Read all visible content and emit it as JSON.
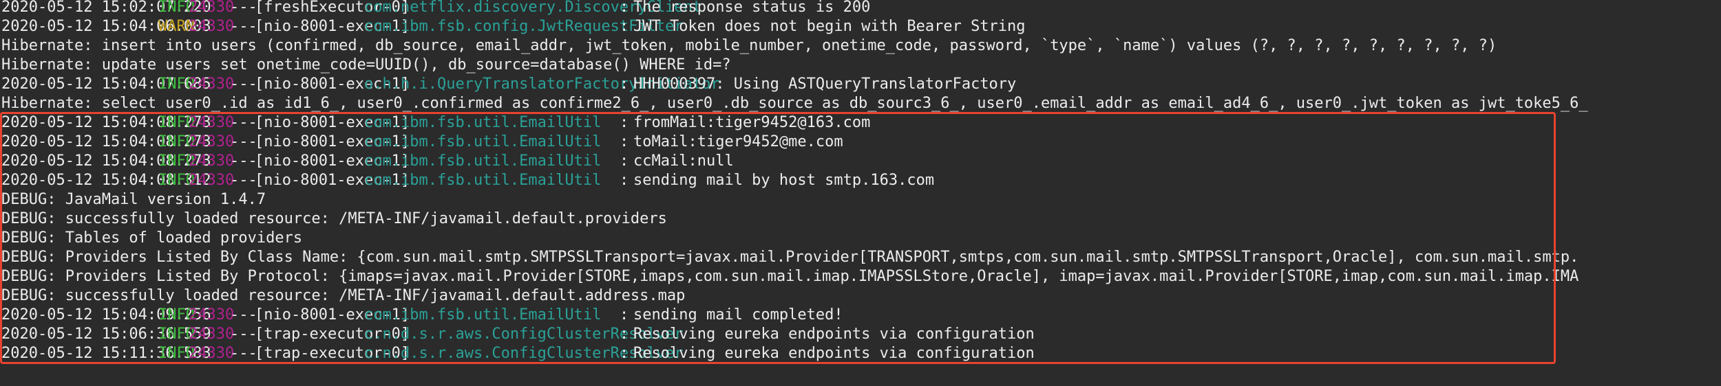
{
  "terminal": {
    "lines": [
      {
        "kind": "log",
        "ts": "2020-05-12 15:02:07.220",
        "level": "INFO",
        "pid": "24330",
        "sep": "---",
        "thread": "[freshExecutor-0]",
        "logger": "com.netflix.discovery.DiscoveryClient",
        "msg": "The response status is 200"
      },
      {
        "kind": "log",
        "ts": "2020-05-12 15:04:06.003",
        "level": "WARN",
        "pid": "24330",
        "sep": "---",
        "thread": "[nio-8001-exec-1]",
        "logger": "com.ibm.fsb.config.JwtRequestFilter",
        "msg": "JWT Token does not begin with Bearer String"
      },
      {
        "kind": "plain",
        "text": "Hibernate: insert into users (confirmed, db_source, email_addr, jwt_token, mobile_number, onetime_code, password, `type`, `name`) values (?, ?, ?, ?, ?, ?, ?, ?, ?)"
      },
      {
        "kind": "plain",
        "text": "Hibernate: update users set onetime_code=UUID(), db_source=database() WHERE id=?"
      },
      {
        "kind": "log",
        "ts": "2020-05-12 15:04:07.685",
        "level": "INFO",
        "pid": "24330",
        "sep": "---",
        "thread": "[nio-8001-exec-1]",
        "logger": "o.h.h.i.QueryTranslatorFactoryInitiator",
        "msg": "HHH000397: Using ASTQueryTranslatorFactory"
      },
      {
        "kind": "plain",
        "text": "Hibernate: select user0_.id as id1_6_, user0_.confirmed as confirme2_6_, user0_.db_source as db_sourc3_6_, user0_.email_addr as email_ad4_6_, user0_.jwt_token as jwt_toke5_6_"
      },
      {
        "kind": "log",
        "ts": "2020-05-12 15:04:08.273",
        "level": "INFO",
        "pid": "24330",
        "sep": "---",
        "thread": "[nio-8001-exec-1]",
        "logger": "com.ibm.fsb.util.EmailUtil",
        "msg": "fromMail:tiger9452@163.com"
      },
      {
        "kind": "log",
        "ts": "2020-05-12 15:04:08.273",
        "level": "INFO",
        "pid": "24330",
        "sep": "---",
        "thread": "[nio-8001-exec-1]",
        "logger": "com.ibm.fsb.util.EmailUtil",
        "msg": "toMail:tiger9452@me.com"
      },
      {
        "kind": "log",
        "ts": "2020-05-12 15:04:08.273",
        "level": "INFO",
        "pid": "24330",
        "sep": "---",
        "thread": "[nio-8001-exec-1]",
        "logger": "com.ibm.fsb.util.EmailUtil",
        "msg": "ccMail:null"
      },
      {
        "kind": "log",
        "ts": "2020-05-12 15:04:08.312",
        "level": "INFO",
        "pid": "24330",
        "sep": "---",
        "thread": "[nio-8001-exec-1]",
        "logger": "com.ibm.fsb.util.EmailUtil",
        "msg": "sending mail by host smtp.163.com"
      },
      {
        "kind": "plain",
        "text": "DEBUG: JavaMail version 1.4.7"
      },
      {
        "kind": "plain",
        "text": "DEBUG: successfully loaded resource: /META-INF/javamail.default.providers"
      },
      {
        "kind": "plain",
        "text": "DEBUG: Tables of loaded providers"
      },
      {
        "kind": "plain",
        "text": "DEBUG: Providers Listed By Class Name: {com.sun.mail.smtp.SMTPSSLTransport=javax.mail.Provider[TRANSPORT,smtps,com.sun.mail.smtp.SMTPSSLTransport,Oracle], com.sun.mail.smtp."
      },
      {
        "kind": "plain",
        "text": "DEBUG: Providers Listed By Protocol: {imaps=javax.mail.Provider[STORE,imaps,com.sun.mail.imap.IMAPSSLStore,Oracle], imap=javax.mail.Provider[STORE,imap,com.sun.mail.imap.IMA"
      },
      {
        "kind": "plain",
        "text": "DEBUG: successfully loaded resource: /META-INF/javamail.default.address.map"
      },
      {
        "kind": "log",
        "ts": "2020-05-12 15:04:09.256",
        "level": "INFO",
        "pid": "24330",
        "sep": "---",
        "thread": "[nio-8001-exec-1]",
        "logger": "com.ibm.fsb.util.EmailUtil",
        "msg": "sending mail completed!"
      },
      {
        "kind": "log",
        "ts": "2020-05-12 15:06:36.559",
        "level": "INFO",
        "pid": "24330",
        "sep": "---",
        "thread": "[trap-executor-0]",
        "logger": "c.n.d.s.r.aws.ConfigClusterResolver",
        "msg": "Resolving eureka endpoints via configuration"
      },
      {
        "kind": "log",
        "ts": "2020-05-12 15:11:36.583",
        "level": "INFO",
        "pid": "24330",
        "sep": "---",
        "thread": "[trap-executor-0]",
        "logger": "c.n.d.s.r.aws.ConfigClusterResolver",
        "msg": "Resolving eureka endpoints via configuration"
      }
    ]
  },
  "colors": {
    "background": "#2b2b2b",
    "text": "#ececec",
    "info": "#3fbf3f",
    "warn": "#c6a31e",
    "pid": "#b0218f",
    "logger": "#2aa198",
    "highlight_border": "#e8432f"
  }
}
